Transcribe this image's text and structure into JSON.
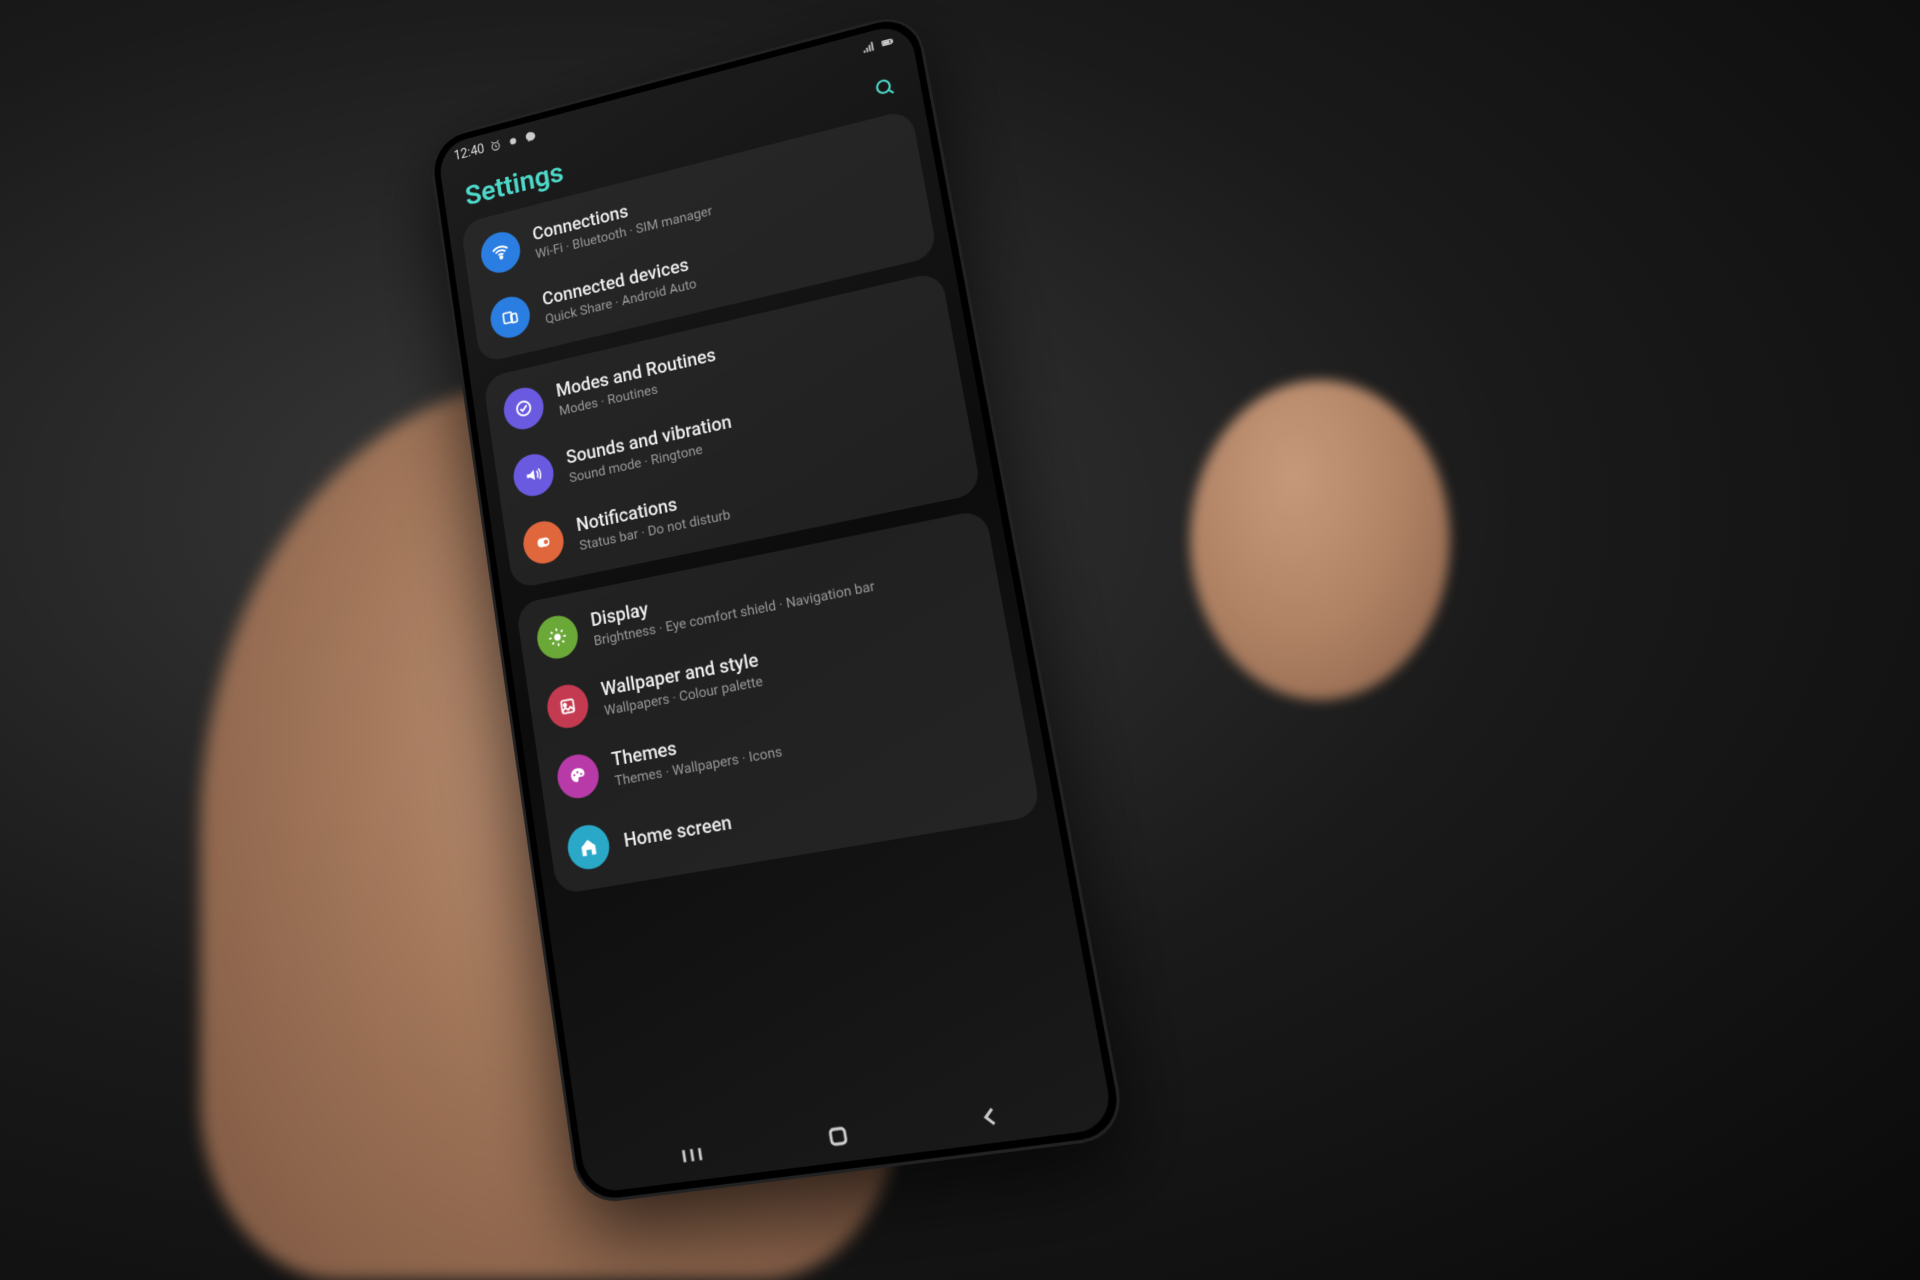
{
  "statusbar": {
    "time": "12:40"
  },
  "header": {
    "title": "Settings"
  },
  "groups": [
    {
      "items": [
        {
          "id": "connections",
          "color": "ic-blue",
          "title": "Connections",
          "sub": "Wi-Fi · Bluetooth · SIM manager",
          "icon": "wifi"
        },
        {
          "id": "connected-devices",
          "color": "ic-blue2",
          "title": "Connected devices",
          "sub": "Quick Share · Android Auto",
          "icon": "devices"
        }
      ]
    },
    {
      "items": [
        {
          "id": "modes-routines",
          "color": "ic-purple",
          "title": "Modes and Routines",
          "sub": "Modes · Routines",
          "icon": "modes"
        },
        {
          "id": "sounds-vibration",
          "color": "ic-purple2",
          "title": "Sounds and vibration",
          "sub": "Sound mode · Ringtone",
          "icon": "sound"
        },
        {
          "id": "notifications",
          "color": "ic-orange",
          "title": "Notifications",
          "sub": "Status bar · Do not disturb",
          "icon": "notif"
        }
      ]
    },
    {
      "items": [
        {
          "id": "display",
          "color": "ic-green",
          "title": "Display",
          "sub": "Brightness · Eye comfort shield · Navigation bar",
          "icon": "display"
        },
        {
          "id": "wallpaper-style",
          "color": "ic-red",
          "title": "Wallpaper and style",
          "sub": "Wallpapers · Colour palette",
          "icon": "wallpaper"
        },
        {
          "id": "themes",
          "color": "ic-magenta",
          "title": "Themes",
          "sub": "Themes · Wallpapers · Icons",
          "icon": "themes"
        },
        {
          "id": "home-screen",
          "color": "ic-cyan",
          "title": "Home screen",
          "sub": "",
          "icon": "home"
        }
      ]
    }
  ]
}
